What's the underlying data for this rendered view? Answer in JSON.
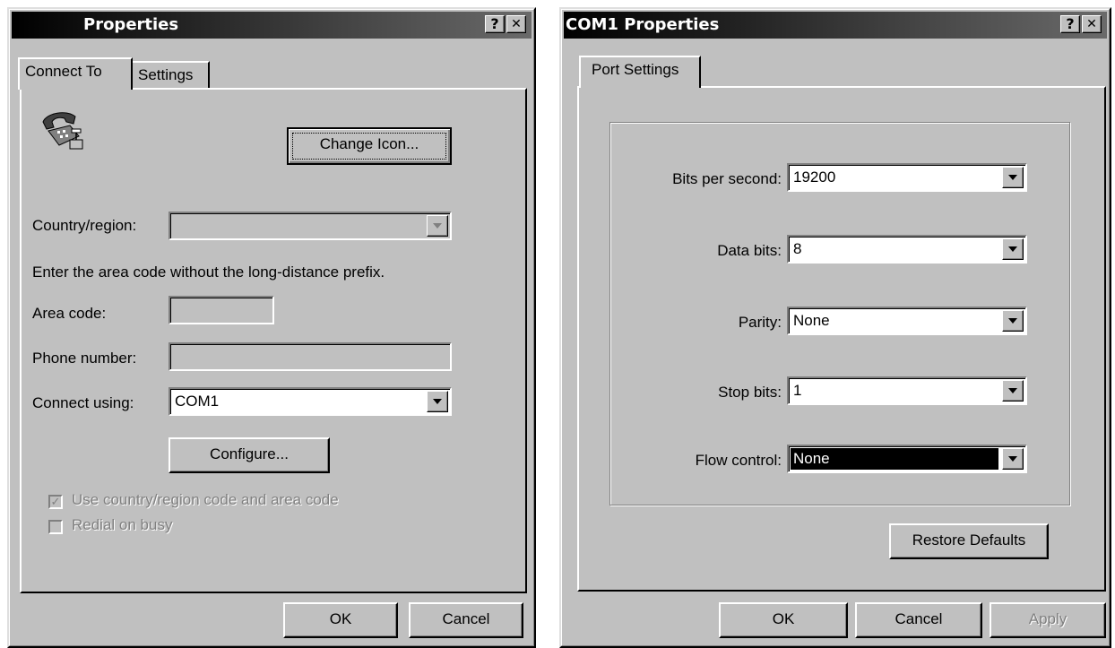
{
  "left_dialog": {
    "title": "Properties",
    "help_button": "?",
    "close_button": "✕",
    "tabs": [
      {
        "label": "Connect To",
        "active": true
      },
      {
        "label": "Settings",
        "active": false
      }
    ],
    "change_icon_button": "Change Icon...",
    "country_region_label": "Country/region:",
    "country_region_value": "",
    "instruction_text": "Enter the area code without the long-distance prefix.",
    "area_code_label": "Area code:",
    "area_code_value": "",
    "phone_number_label": "Phone number:",
    "phone_number_value": "",
    "connect_using_label": "Connect using:",
    "connect_using_value": "COM1",
    "configure_button": "Configure...",
    "use_country_checkbox": {
      "label": "Use country/region code and area code",
      "checked": true,
      "enabled": false
    },
    "redial_checkbox": {
      "label": "Redial on busy",
      "checked": false,
      "enabled": false
    },
    "ok_button": "OK",
    "cancel_button": "Cancel"
  },
  "right_dialog": {
    "title": "COM1 Properties",
    "help_button": "?",
    "close_button": "✕",
    "tabs": [
      {
        "label": "Port Settings",
        "active": true
      }
    ],
    "fields": [
      {
        "label": "Bits per second:",
        "value": "19200"
      },
      {
        "label": "Data bits:",
        "value": "8"
      },
      {
        "label": "Parity:",
        "value": "None"
      },
      {
        "label": "Stop bits:",
        "value": "1"
      },
      {
        "label": "Flow control:",
        "value": "None"
      }
    ],
    "restore_defaults_button": "Restore Defaults",
    "ok_button": "OK",
    "cancel_button": "Cancel",
    "apply_button": "Apply"
  },
  "colors": {
    "dialog_face": "#c0c0c0",
    "titlebar_start": "#000000",
    "titlebar_end": "#6a6a6a",
    "selection": "#000000"
  },
  "icons": {
    "phone": "telephone-icon",
    "dropdown": "chevron-down-icon"
  }
}
